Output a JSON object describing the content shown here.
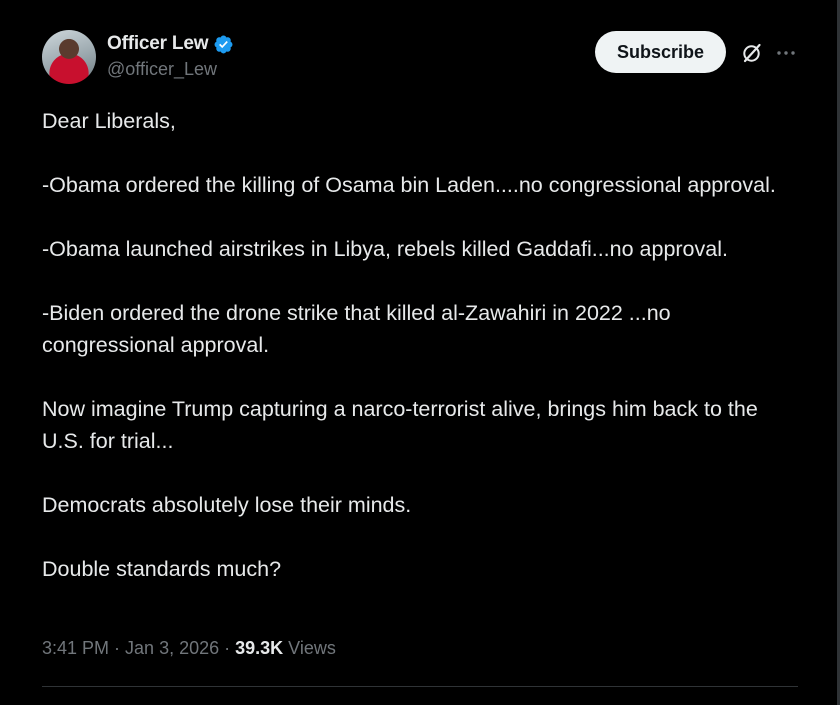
{
  "author": {
    "display_name": "Officer Lew",
    "handle": "@officer_Lew",
    "verified": true,
    "verified_color": "#1d9bf0"
  },
  "actions": {
    "subscribe_label": "Subscribe",
    "grok_icon": "grok-icon",
    "more_icon": "more-icon"
  },
  "post": {
    "paragraphs": [
      "Dear Liberals,",
      "-Obama ordered the killing of Osama bin Laden....no congressional approval.",
      "-Obama launched airstrikes in Libya, rebels killed Gaddafi...no approval.",
      "-Biden ordered the drone strike that killed al-Zawahiri in 2022 ...no congressional approval.",
      "Now imagine Trump capturing a narco-terrorist alive, brings him back to the U.S. for trial...",
      "Democrats absolutely lose their minds.",
      "Double standards much?"
    ]
  },
  "meta": {
    "time": "3:41 PM",
    "separator": " · ",
    "date": "Jan 3, 2026",
    "views_count": "39.3K",
    "views_label": " Views"
  },
  "colors": {
    "background": "#000000",
    "text_primary": "#e7e9ea",
    "text_secondary": "#71767b",
    "divider": "#2f3336",
    "button_bg": "#eff3f4"
  }
}
